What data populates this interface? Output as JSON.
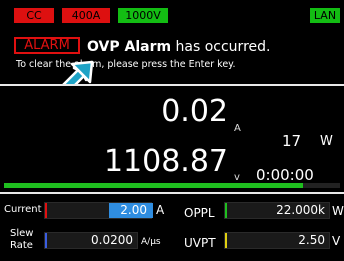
{
  "status_bar": {
    "mode": "CC",
    "current_range": "400A",
    "voltage_range": "1000V",
    "network": "LAN"
  },
  "alarm": {
    "tag": "ALARM",
    "title_bold": "OVP Alarm",
    "title_rest": " has occurred.",
    "hint": "To clear the alarm, please press the Enter key."
  },
  "measurement": {
    "current_value": "0.02",
    "current_unit": "A",
    "voltage_value": "1108.87",
    "voltage_unit": "V",
    "power_value": "17",
    "power_unit": "W",
    "elapsed_time": "0:00:00",
    "progress_fraction": 0.89
  },
  "settings": {
    "current_label": "Current",
    "current_setpoint": "2.00",
    "current_unit": "A",
    "slew_label_line1": "Slew",
    "slew_label_line2": "Rate",
    "slew_value": "0.0200",
    "slew_unit": "A/µs",
    "oppl_label": "OPPL",
    "oppl_value": "22.000k",
    "oppl_unit": "W",
    "uvpt_label": "UVPT",
    "uvpt_value": "2.50",
    "uvpt_unit": "V"
  },
  "colors": {
    "alarm_red": "#e01010",
    "status_green": "#13bd13",
    "progress_green": "#1fbf1f",
    "selected_field_blue": "#2f8de0",
    "pointer_arrow": "#1ea3c6"
  },
  "icons": {
    "pointer": "pointer-arrow-icon"
  }
}
